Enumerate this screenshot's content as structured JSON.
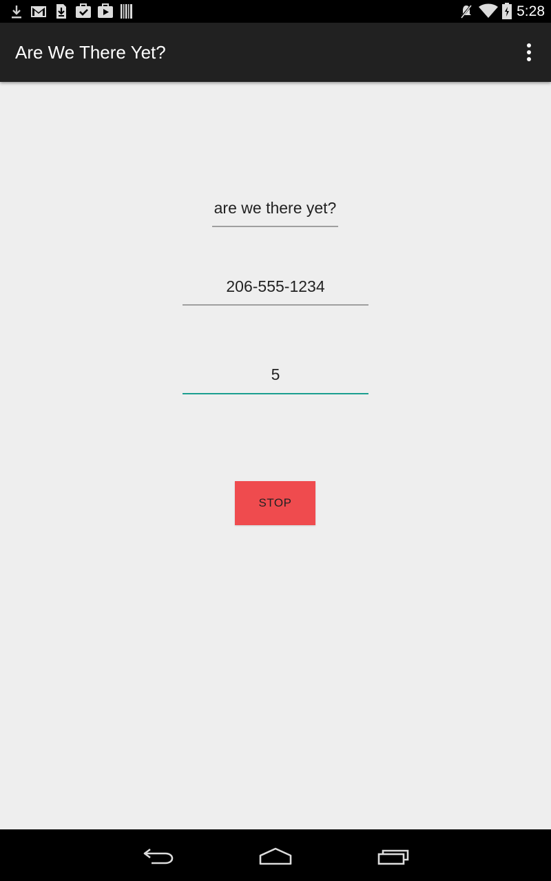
{
  "status_bar": {
    "time": "5:28",
    "left_icons": [
      "download-icon",
      "gmail-icon",
      "sim-download-icon",
      "briefcase-check-icon",
      "briefcase-play-icon",
      "barcode-icon"
    ],
    "right_icons": [
      "mute-icon",
      "wifi-icon",
      "battery-icon"
    ]
  },
  "action_bar": {
    "title": "Are We There Yet?",
    "overflow_icon": "overflow-menu-icon"
  },
  "form": {
    "message": "are we there yet?",
    "phone": "206-555-1234",
    "minutes": "5",
    "stop_label": "STOP"
  },
  "colors": {
    "stop_button": "#ef4b4e",
    "active_underline": "#1a9e8f",
    "action_bar": "#212121",
    "background": "#eeeeee"
  },
  "nav_bar": {
    "buttons": [
      "back-icon",
      "home-icon",
      "recents-icon"
    ]
  }
}
